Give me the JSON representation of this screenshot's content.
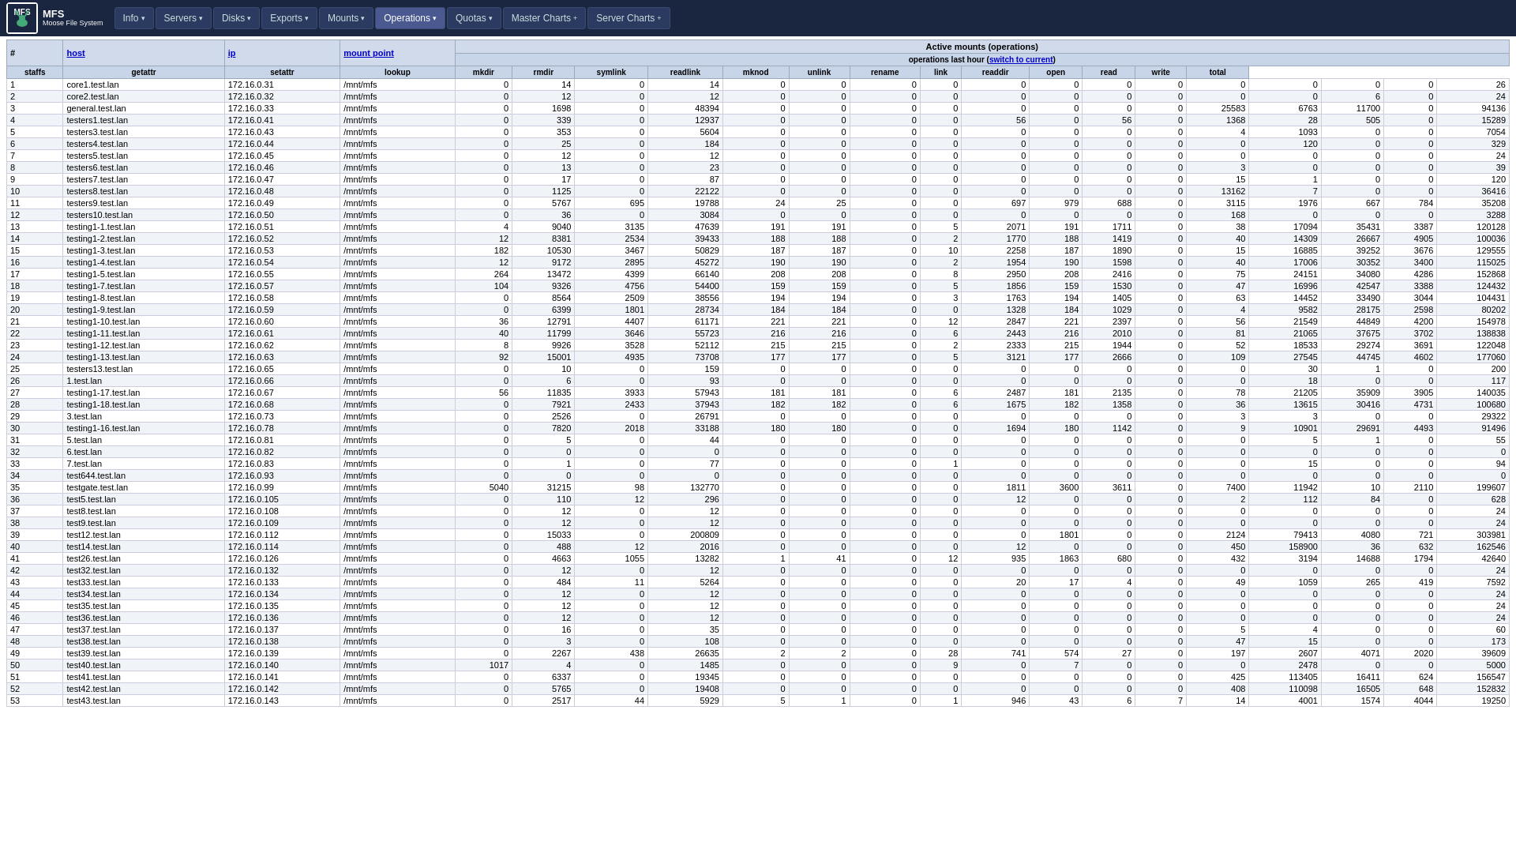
{
  "nav": {
    "logo": "MFS",
    "logo_sub": "Moose File System",
    "items": [
      {
        "label": "Info",
        "arrow": "▾",
        "active": false
      },
      {
        "label": "Servers",
        "arrow": "▾",
        "active": false
      },
      {
        "label": "Disks",
        "arrow": "▾",
        "active": false
      },
      {
        "label": "Exports",
        "arrow": "▾",
        "active": false
      },
      {
        "label": "Mounts",
        "arrow": "▾",
        "active": false
      },
      {
        "label": "Operations",
        "arrow": "▾",
        "active": true
      },
      {
        "label": "Quotas",
        "arrow": "▾",
        "active": false
      },
      {
        "label": "Master Charts",
        "arrow": "+",
        "active": false
      },
      {
        "label": "Server Charts",
        "arrow": "+",
        "active": false
      }
    ]
  },
  "main": {
    "section_title": "Active mounts (operations)",
    "ops_header": "operations last hour (switch to current)",
    "switch_link": "switch to current",
    "col_headers": [
      "#",
      "host",
      "ip",
      "mount point",
      "staffs",
      "getattr",
      "setattr",
      "lookup",
      "mkdir",
      "rmdir",
      "symlink",
      "readlink",
      "mknod",
      "unlink",
      "rename",
      "link",
      "readdir",
      "open",
      "read",
      "write",
      "total"
    ],
    "rows": [
      [
        1,
        "core1.test.lan",
        "172.16.0.31",
        "/mnt/mfs",
        0,
        14,
        0,
        14,
        0,
        0,
        0,
        0,
        0,
        0,
        0,
        0,
        0,
        0,
        0,
        0,
        26
      ],
      [
        2,
        "core2.test.lan",
        "172.16.0.32",
        "/mnt/mfs",
        0,
        12,
        0,
        12,
        0,
        0,
        0,
        0,
        0,
        0,
        0,
        0,
        0,
        0,
        6,
        0,
        24
      ],
      [
        3,
        "general.test.lan",
        "172.16.0.33",
        "/mnt/mfs",
        0,
        1698,
        0,
        48394,
        0,
        0,
        0,
        0,
        0,
        0,
        0,
        0,
        25583,
        6763,
        11700,
        0,
        94136
      ],
      [
        4,
        "testers1.test.lan",
        "172.16.0.41",
        "/mnt/mfs",
        0,
        339,
        0,
        12937,
        0,
        0,
        0,
        0,
        56,
        0,
        56,
        0,
        1368,
        28,
        505,
        0,
        15289
      ],
      [
        5,
        "testers3.test.lan",
        "172.16.0.43",
        "/mnt/mfs",
        0,
        353,
        0,
        5604,
        0,
        0,
        0,
        0,
        0,
        0,
        0,
        0,
        4,
        1093,
        0,
        0,
        7054
      ],
      [
        6,
        "testers4.test.lan",
        "172.16.0.44",
        "/mnt/mfs",
        0,
        25,
        0,
        184,
        0,
        0,
        0,
        0,
        0,
        0,
        0,
        0,
        0,
        120,
        0,
        0,
        329
      ],
      [
        7,
        "testers5.test.lan",
        "172.16.0.45",
        "/mnt/mfs",
        0,
        12,
        0,
        12,
        0,
        0,
        0,
        0,
        0,
        0,
        0,
        0,
        0,
        0,
        0,
        0,
        24
      ],
      [
        8,
        "testers6.test.lan",
        "172.16.0.46",
        "/mnt/mfs",
        0,
        13,
        0,
        23,
        0,
        0,
        0,
        0,
        0,
        0,
        0,
        0,
        3,
        0,
        0,
        0,
        39
      ],
      [
        9,
        "testers7.test.lan",
        "172.16.0.47",
        "/mnt/mfs",
        0,
        17,
        0,
        87,
        0,
        0,
        0,
        0,
        0,
        0,
        0,
        0,
        15,
        1,
        0,
        0,
        120
      ],
      [
        10,
        "testers8.test.lan",
        "172.16.0.48",
        "/mnt/mfs",
        0,
        1125,
        0,
        22122,
        0,
        0,
        0,
        0,
        0,
        0,
        0,
        0,
        13162,
        7,
        0,
        0,
        36416
      ],
      [
        11,
        "testers9.test.lan",
        "172.16.0.49",
        "/mnt/mfs",
        0,
        5767,
        695,
        19788,
        24,
        25,
        0,
        0,
        697,
        979,
        688,
        0,
        3115,
        1976,
        667,
        784,
        35208
      ],
      [
        12,
        "testers10.test.lan",
        "172.16.0.50",
        "/mnt/mfs",
        0,
        36,
        0,
        3084,
        0,
        0,
        0,
        0,
        0,
        0,
        0,
        0,
        168,
        0,
        0,
        0,
        3288
      ],
      [
        13,
        "testing1-1.test.lan",
        "172.16.0.51",
        "/mnt/mfs",
        4,
        9040,
        3135,
        47639,
        191,
        191,
        0,
        5,
        2071,
        191,
        1711,
        0,
        38,
        17094,
        35431,
        3387,
        120128
      ],
      [
        14,
        "testing1-2.test.lan",
        "172.16.0.52",
        "/mnt/mfs",
        12,
        8381,
        2534,
        39433,
        188,
        188,
        0,
        2,
        1770,
        188,
        1419,
        0,
        40,
        14309,
        26667,
        4905,
        100036
      ],
      [
        15,
        "testing1-3.test.lan",
        "172.16.0.53",
        "/mnt/mfs",
        182,
        10530,
        3467,
        50829,
        187,
        187,
        0,
        10,
        2258,
        187,
        1890,
        0,
        15,
        16885,
        39252,
        3676,
        129555
      ],
      [
        16,
        "testing1-4.test.lan",
        "172.16.0.54",
        "/mnt/mfs",
        12,
        9172,
        2895,
        45272,
        190,
        190,
        0,
        2,
        1954,
        190,
        1598,
        0,
        40,
        17006,
        30352,
        3400,
        115025
      ],
      [
        17,
        "testing1-5.test.lan",
        "172.16.0.55",
        "/mnt/mfs",
        264,
        13472,
        4399,
        66140,
        208,
        208,
        0,
        8,
        2950,
        208,
        2416,
        0,
        75,
        24151,
        34080,
        4286,
        152868
      ],
      [
        18,
        "testing1-7.test.lan",
        "172.16.0.57",
        "/mnt/mfs",
        104,
        9326,
        4756,
        54400,
        159,
        159,
        0,
        5,
        1856,
        159,
        1530,
        0,
        47,
        16996,
        42547,
        3388,
        124432
      ],
      [
        19,
        "testing1-8.test.lan",
        "172.16.0.58",
        "/mnt/mfs",
        0,
        8564,
        2509,
        38556,
        194,
        194,
        0,
        3,
        1763,
        194,
        1405,
        0,
        63,
        14452,
        33490,
        3044,
        104431
      ],
      [
        20,
        "testing1-9.test.lan",
        "172.16.0.59",
        "/mnt/mfs",
        0,
        6399,
        1801,
        28734,
        184,
        184,
        0,
        0,
        1328,
        184,
        1029,
        0,
        4,
        9582,
        28175,
        2598,
        80202
      ],
      [
        21,
        "testing1-10.test.lan",
        "172.16.0.60",
        "/mnt/mfs",
        36,
        12791,
        4407,
        61171,
        221,
        221,
        0,
        12,
        2847,
        221,
        2397,
        0,
        56,
        21549,
        44849,
        4200,
        154978
      ],
      [
        22,
        "testing1-11.test.lan",
        "172.16.0.61",
        "/mnt/mfs",
        40,
        11799,
        3646,
        55723,
        216,
        216,
        0,
        6,
        2443,
        216,
        2010,
        0,
        81,
        21065,
        37675,
        3702,
        138838
      ],
      [
        23,
        "testing1-12.test.lan",
        "172.16.0.62",
        "/mnt/mfs",
        8,
        9926,
        3528,
        52112,
        215,
        215,
        0,
        2,
        2333,
        215,
        1944,
        0,
        52,
        18533,
        29274,
        3691,
        122048
      ],
      [
        24,
        "testing1-13.test.lan",
        "172.16.0.63",
        "/mnt/mfs",
        92,
        15001,
        4935,
        73708,
        177,
        177,
        0,
        5,
        3121,
        177,
        2666,
        0,
        109,
        27545,
        44745,
        4602,
        177060
      ],
      [
        25,
        "testers13.test.lan",
        "172.16.0.65",
        "/mnt/mfs",
        0,
        10,
        0,
        159,
        0,
        0,
        0,
        0,
        0,
        0,
        0,
        0,
        0,
        30,
        1,
        0,
        200
      ],
      [
        26,
        "1.test.lan",
        "172.16.0.66",
        "/mnt/mfs",
        0,
        6,
        0,
        93,
        0,
        0,
        0,
        0,
        0,
        0,
        0,
        0,
        0,
        18,
        0,
        0,
        117
      ],
      [
        27,
        "testing1-17.test.lan",
        "172.16.0.67",
        "/mnt/mfs",
        56,
        11835,
        3933,
        57943,
        181,
        181,
        0,
        6,
        2487,
        181,
        2135,
        0,
        78,
        21205,
        35909,
        3905,
        140035
      ],
      [
        28,
        "testing1-18.test.lan",
        "172.16.0.68",
        "/mnt/mfs",
        0,
        7921,
        2433,
        37943,
        182,
        182,
        0,
        6,
        1675,
        182,
        1358,
        0,
        36,
        13615,
        30416,
        4731,
        100680
      ],
      [
        29,
        "3.test.lan",
        "172.16.0.73",
        "/mnt/mfs",
        0,
        2526,
        0,
        26791,
        0,
        0,
        0,
        0,
        0,
        0,
        0,
        0,
        3,
        3,
        0,
        0,
        29322
      ],
      [
        30,
        "testing1-16.test.lan",
        "172.16.0.78",
        "/mnt/mfs",
        0,
        7820,
        2018,
        33188,
        180,
        180,
        0,
        0,
        1694,
        180,
        1142,
        0,
        9,
        10901,
        29691,
        4493,
        91496
      ],
      [
        31,
        "5.test.lan",
        "172.16.0.81",
        "/mnt/mfs",
        0,
        5,
        0,
        44,
        0,
        0,
        0,
        0,
        0,
        0,
        0,
        0,
        0,
        5,
        1,
        0,
        55
      ],
      [
        32,
        "6.test.lan",
        "172.16.0.82",
        "/mnt/mfs",
        0,
        0,
        0,
        0,
        0,
        0,
        0,
        0,
        0,
        0,
        0,
        0,
        0,
        0,
        0,
        0,
        0
      ],
      [
        33,
        "7.test.lan",
        "172.16.0.83",
        "/mnt/mfs",
        0,
        1,
        0,
        77,
        0,
        0,
        0,
        1,
        0,
        0,
        0,
        0,
        0,
        15,
        0,
        0,
        94
      ],
      [
        34,
        "test644.test.lan",
        "172.16.0.93",
        "/mnt/mfs",
        0,
        0,
        0,
        0,
        0,
        0,
        0,
        0,
        0,
        0,
        0,
        0,
        0,
        0,
        0,
        0,
        0
      ],
      [
        35,
        "testgate.test.lan",
        "172.16.0.99",
        "/mnt/mfs",
        5040,
        31215,
        98,
        132770,
        0,
        0,
        0,
        0,
        1811,
        3600,
        3611,
        0,
        7400,
        11942,
        10,
        2110,
        199607
      ],
      [
        36,
        "test5.test.lan",
        "172.16.0.105",
        "/mnt/mfs",
        0,
        110,
        12,
        296,
        0,
        0,
        0,
        0,
        12,
        0,
        0,
        0,
        2,
        112,
        84,
        0,
        628
      ],
      [
        37,
        "test8.test.lan",
        "172.16.0.108",
        "/mnt/mfs",
        0,
        12,
        0,
        12,
        0,
        0,
        0,
        0,
        0,
        0,
        0,
        0,
        0,
        0,
        0,
        0,
        24
      ],
      [
        38,
        "test9.test.lan",
        "172.16.0.109",
        "/mnt/mfs",
        0,
        12,
        0,
        12,
        0,
        0,
        0,
        0,
        0,
        0,
        0,
        0,
        0,
        0,
        0,
        0,
        24
      ],
      [
        39,
        "test12.test.lan",
        "172.16.0.112",
        "/mnt/mfs",
        0,
        15033,
        0,
        200809,
        0,
        0,
        0,
        0,
        0,
        1801,
        0,
        0,
        2124,
        79413,
        4080,
        721,
        303981
      ],
      [
        40,
        "test14.test.lan",
        "172.16.0.114",
        "/mnt/mfs",
        0,
        488,
        12,
        2016,
        0,
        0,
        0,
        0,
        12,
        0,
        0,
        0,
        450,
        158900,
        36,
        632,
        162546
      ],
      [
        41,
        "test26.test.lan",
        "172.16.0.126",
        "/mnt/mfs",
        0,
        4663,
        1055,
        13282,
        1,
        41,
        0,
        12,
        935,
        1863,
        680,
        0,
        432,
        3194,
        14688,
        1794,
        42640
      ],
      [
        42,
        "test32.test.lan",
        "172.16.0.132",
        "/mnt/mfs",
        0,
        12,
        0,
        12,
        0,
        0,
        0,
        0,
        0,
        0,
        0,
        0,
        0,
        0,
        0,
        0,
        24
      ],
      [
        43,
        "test33.test.lan",
        "172.16.0.133",
        "/mnt/mfs",
        0,
        484,
        11,
        5264,
        0,
        0,
        0,
        0,
        20,
        17,
        4,
        0,
        49,
        1059,
        265,
        419,
        7592
      ],
      [
        44,
        "test34.test.lan",
        "172.16.0.134",
        "/mnt/mfs",
        0,
        12,
        0,
        12,
        0,
        0,
        0,
        0,
        0,
        0,
        0,
        0,
        0,
        0,
        0,
        0,
        24
      ],
      [
        45,
        "test35.test.lan",
        "172.16.0.135",
        "/mnt/mfs",
        0,
        12,
        0,
        12,
        0,
        0,
        0,
        0,
        0,
        0,
        0,
        0,
        0,
        0,
        0,
        0,
        24
      ],
      [
        46,
        "test36.test.lan",
        "172.16.0.136",
        "/mnt/mfs",
        0,
        12,
        0,
        12,
        0,
        0,
        0,
        0,
        0,
        0,
        0,
        0,
        0,
        0,
        0,
        0,
        24
      ],
      [
        47,
        "test37.test.lan",
        "172.16.0.137",
        "/mnt/mfs",
        0,
        16,
        0,
        35,
        0,
        0,
        0,
        0,
        0,
        0,
        0,
        0,
        5,
        4,
        0,
        0,
        60
      ],
      [
        48,
        "test38.test.lan",
        "172.16.0.138",
        "/mnt/mfs",
        0,
        3,
        0,
        108,
        0,
        0,
        0,
        0,
        0,
        0,
        0,
        0,
        47,
        15,
        0,
        0,
        173
      ],
      [
        49,
        "test39.test.lan",
        "172.16.0.139",
        "/mnt/mfs",
        0,
        2267,
        438,
        26635,
        2,
        2,
        0,
        28,
        741,
        574,
        27,
        0,
        197,
        2607,
        4071,
        2020,
        39609
      ],
      [
        50,
        "test40.test.lan",
        "172.16.0.140",
        "/mnt/mfs",
        1017,
        4,
        0,
        1485,
        0,
        0,
        0,
        9,
        0,
        7,
        0,
        0,
        0,
        2478,
        0,
        0,
        5000
      ],
      [
        51,
        "test41.test.lan",
        "172.16.0.141",
        "/mnt/mfs",
        0,
        6337,
        0,
        19345,
        0,
        0,
        0,
        0,
        0,
        0,
        0,
        0,
        425,
        113405,
        16411,
        624,
        156547
      ],
      [
        52,
        "test42.test.lan",
        "172.16.0.142",
        "/mnt/mfs",
        0,
        5765,
        0,
        19408,
        0,
        0,
        0,
        0,
        0,
        0,
        0,
        0,
        408,
        110098,
        16505,
        648,
        152832
      ],
      [
        53,
        "test43.test.lan",
        "172.16.0.143",
        "/mnt/mfs",
        0,
        2517,
        44,
        5929,
        5,
        1,
        0,
        1,
        946,
        43,
        6,
        7,
        14,
        4001,
        1574,
        4044,
        19250
      ]
    ]
  }
}
